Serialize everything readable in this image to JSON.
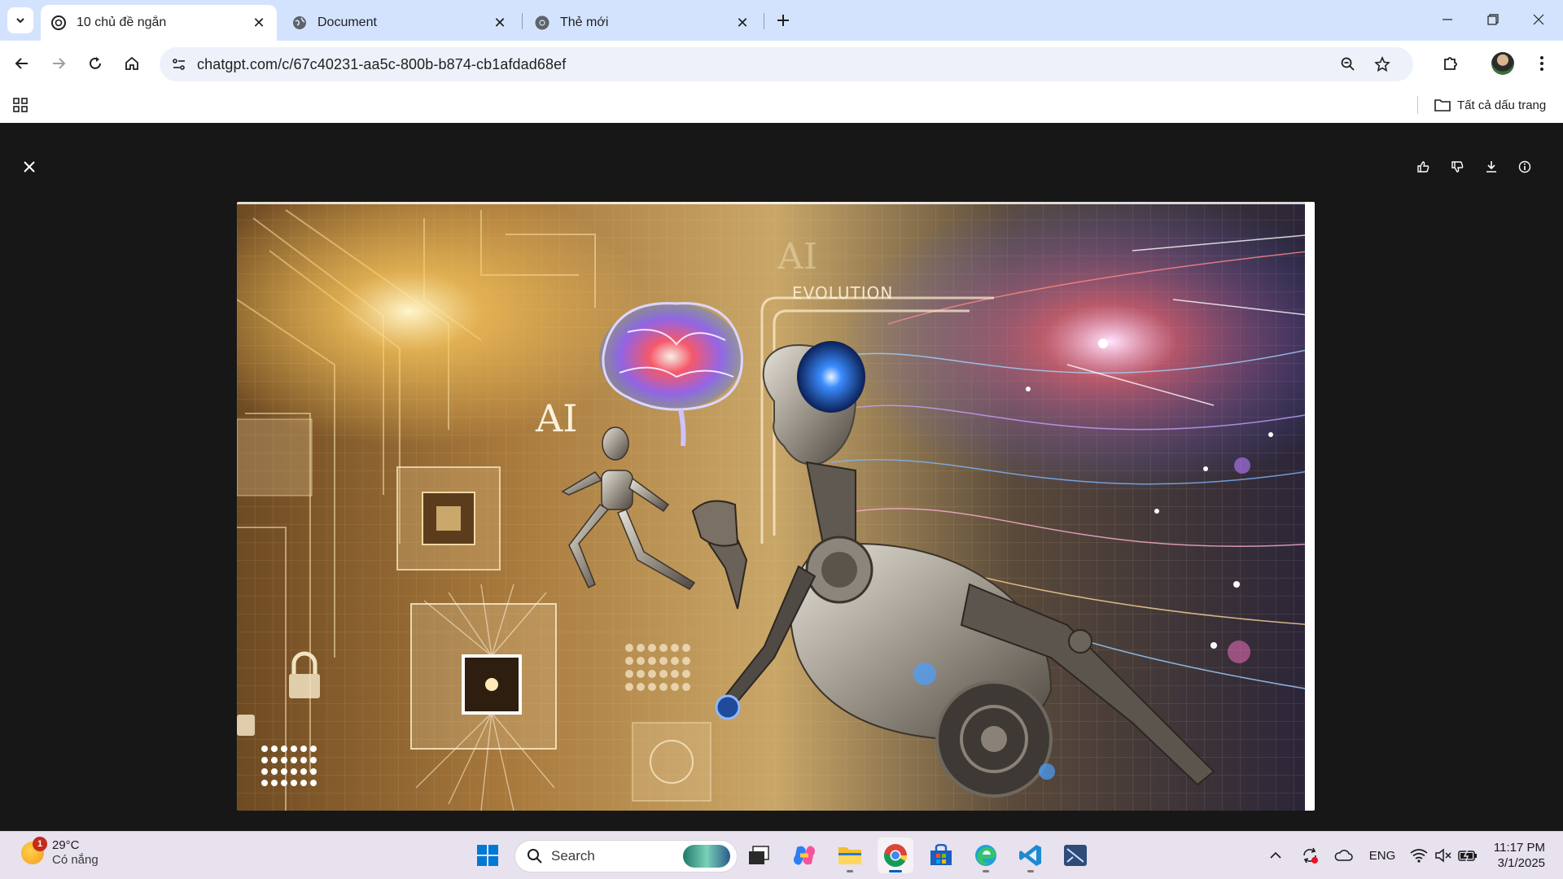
{
  "browser": {
    "tabs": [
      {
        "title": "10 chủ đề ngắn",
        "active": true,
        "favicon": "chatgpt-icon"
      },
      {
        "title": "Document",
        "active": false,
        "favicon": "globe-icon"
      },
      {
        "title": "Thẻ mới",
        "active": false,
        "favicon": "chrome-icon"
      }
    ],
    "url": "chatgpt.com/c/67c40231-aa5c-800b-b874-cb1afdad68ef",
    "bookmarks": {
      "all_bookmarks_label": "Tất cả dấu trang"
    }
  },
  "viewer": {
    "image_text": {
      "evolution": "EVOLUTION",
      "ai_left": "AI",
      "ai_top": "AI"
    },
    "actions": [
      "thumbs-up-icon",
      "thumbs-down-icon",
      "download-icon",
      "info-icon"
    ]
  },
  "taskbar": {
    "weather": {
      "badge": "1",
      "temperature": "29°C",
      "condition": "Có nắng"
    },
    "search_label": "Search",
    "language": "ENG",
    "time": "11:17 PM",
    "date": "3/1/2025"
  },
  "colors": {
    "tabstrip": "#d3e3fd",
    "viewer_bg": "#171717",
    "taskbar": "#e8e1ee",
    "accent": "#005fb8"
  }
}
